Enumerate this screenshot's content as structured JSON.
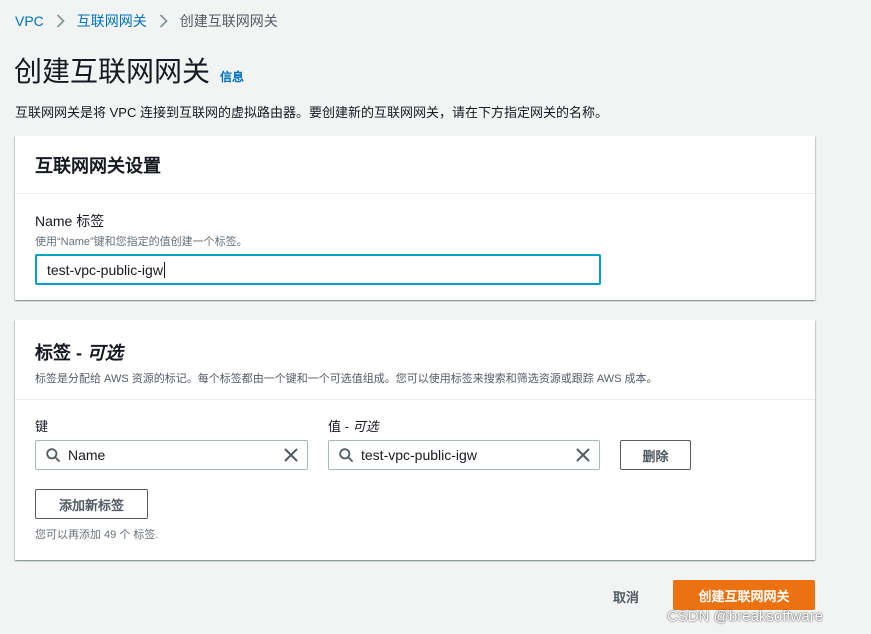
{
  "breadcrumb": {
    "items": [
      "VPC",
      "互联网网关"
    ],
    "current": "创建互联网网关"
  },
  "page": {
    "title": "创建互联网网关",
    "info_link": "信息",
    "description": "互联网网关是将 VPC 连接到互联网的虚拟路由器。要创建新的互联网网关，请在下方指定网关的名称。"
  },
  "settings": {
    "title": "互联网网关设置",
    "name_label": "Name 标签",
    "name_hint": "使用“Name”键和您指定的值创建一个标签。",
    "name_value": "test-vpc-public-igw"
  },
  "tags": {
    "title": "标签 - ",
    "title_optional": "可选",
    "description": "标签是分配给 AWS 资源的标记。每个标签都由一个键和一个可选值组成。您可以使用标签来搜索和筛选资源或跟踪 AWS 成本。",
    "key_label": "键",
    "value_label": "值 - ",
    "value_label_optional": "可选",
    "rows": [
      {
        "key": "Name",
        "value": "test-vpc-public-igw"
      }
    ],
    "remove_label": "删除",
    "add_label": "添加新标签",
    "remaining_hint": "您可以再添加 49 个 标签."
  },
  "footer": {
    "cancel_label": "取消",
    "create_label": "创建互联网网关"
  },
  "watermark": "CSDN @breaksoftware",
  "colors": {
    "link": "#0073bb",
    "primary": "#ec7211",
    "focus": "#00a1c9",
    "background": "#f2f3f3"
  },
  "icons": [
    "chevron-right-icon",
    "search-icon",
    "clear-icon"
  ]
}
